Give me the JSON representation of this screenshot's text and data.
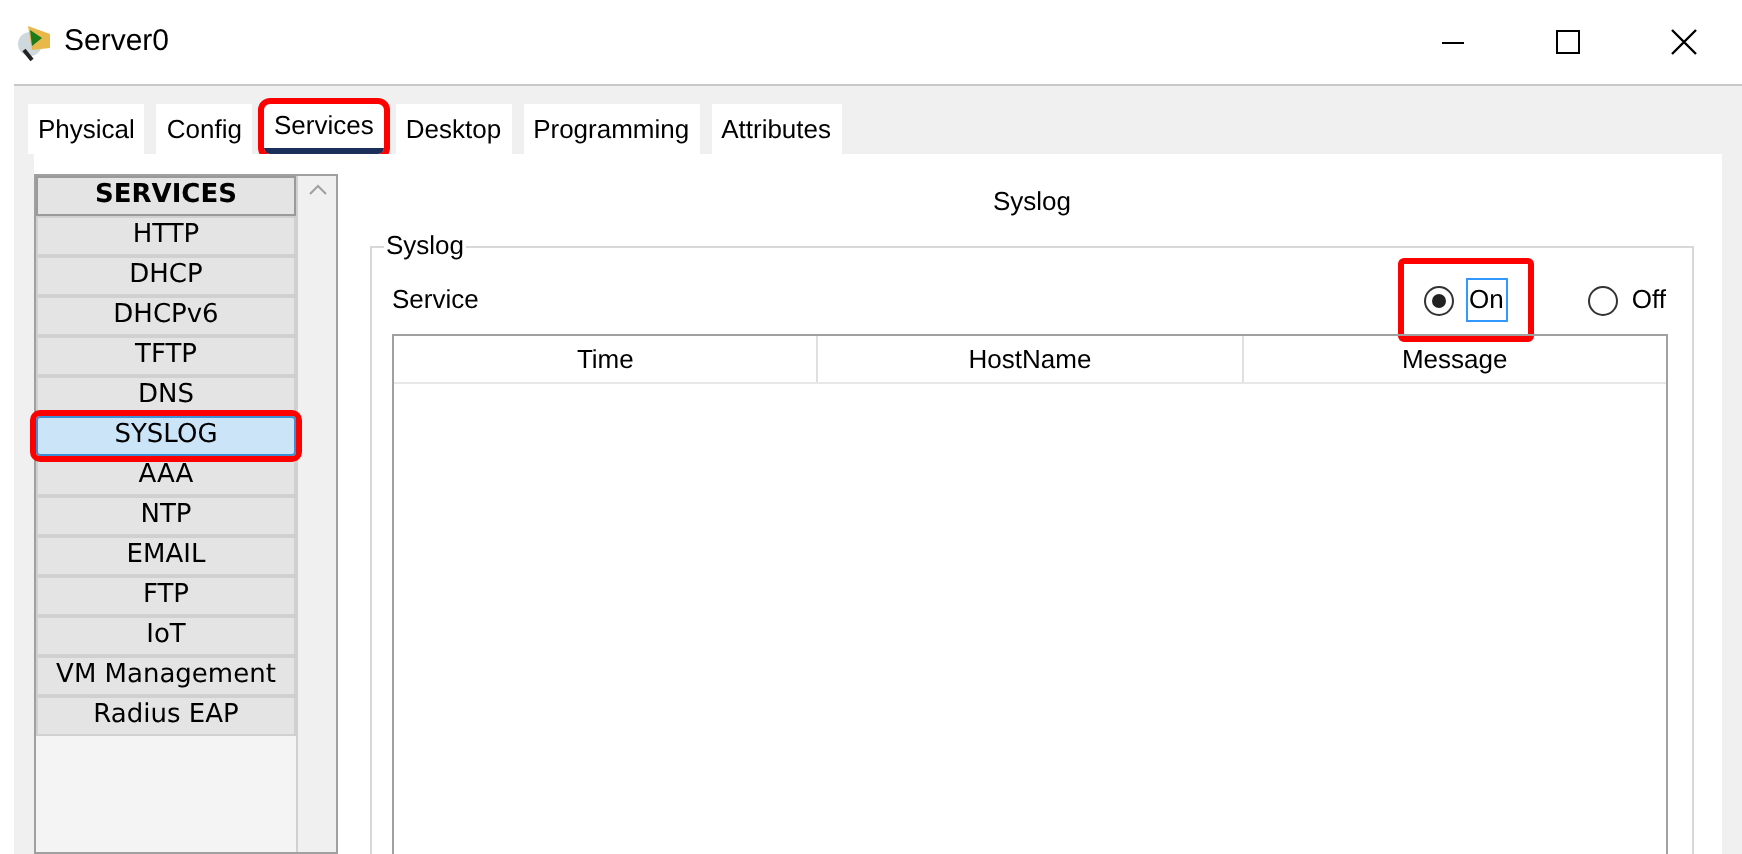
{
  "window": {
    "title": "Server0"
  },
  "tabs": [
    {
      "label": "Physical",
      "selected": false,
      "highlighted": false
    },
    {
      "label": "Config",
      "selected": false,
      "highlighted": false
    },
    {
      "label": "Services",
      "selected": true,
      "highlighted": true
    },
    {
      "label": "Desktop",
      "selected": false,
      "highlighted": false
    },
    {
      "label": "Programming",
      "selected": false,
      "highlighted": false
    },
    {
      "label": "Attributes",
      "selected": false,
      "highlighted": false
    }
  ],
  "sidebar": {
    "heading": "SERVICES",
    "items": [
      {
        "label": "HTTP",
        "selected": false,
        "highlighted": false
      },
      {
        "label": "DHCP",
        "selected": false,
        "highlighted": false
      },
      {
        "label": "DHCPv6",
        "selected": false,
        "highlighted": false
      },
      {
        "label": "TFTP",
        "selected": false,
        "highlighted": false
      },
      {
        "label": "DNS",
        "selected": false,
        "highlighted": false
      },
      {
        "label": "SYSLOG",
        "selected": true,
        "highlighted": true
      },
      {
        "label": "AAA",
        "selected": false,
        "highlighted": false
      },
      {
        "label": "NTP",
        "selected": false,
        "highlighted": false
      },
      {
        "label": "EMAIL",
        "selected": false,
        "highlighted": false
      },
      {
        "label": "FTP",
        "selected": false,
        "highlighted": false
      },
      {
        "label": "IoT",
        "selected": false,
        "highlighted": false
      },
      {
        "label": "VM Management",
        "selected": false,
        "highlighted": false
      },
      {
        "label": "Radius EAP",
        "selected": false,
        "highlighted": false
      }
    ]
  },
  "panel": {
    "title": "Syslog",
    "group_label": "Syslog",
    "service_label": "Service",
    "options": [
      {
        "label": "On",
        "selected": true,
        "highlighted": true
      },
      {
        "label": "Off",
        "selected": false,
        "highlighted": false
      }
    ],
    "table": {
      "columns": [
        "Time",
        "HostName",
        "Message"
      ]
    }
  }
}
